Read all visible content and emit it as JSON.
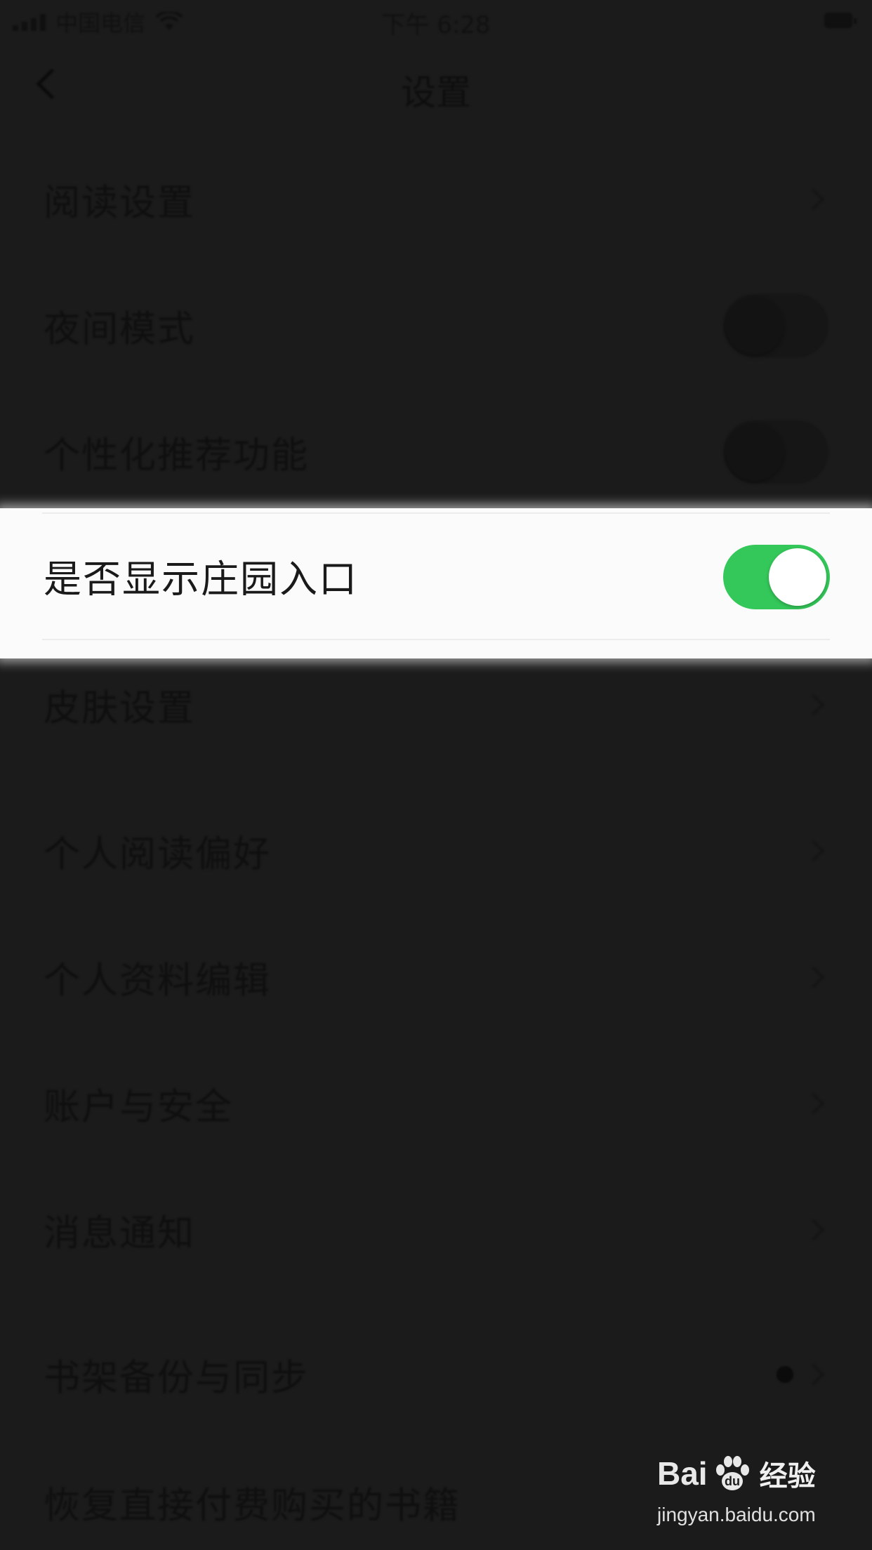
{
  "status_bar": {
    "carrier": "中国电信",
    "time": "下午 6:28"
  },
  "nav": {
    "title": "设置"
  },
  "rows": [
    {
      "label": "阅读设置",
      "accessory": "chevron"
    },
    {
      "label": "夜间模式",
      "accessory": "toggle",
      "on": false
    },
    {
      "label": "个性化推荐功能",
      "accessory": "toggle",
      "on": false
    },
    {
      "label": "是否显示庄园入口",
      "accessory": "toggle",
      "on": true,
      "highlighted": true
    },
    {
      "label": "皮肤设置",
      "accessory": "chevron"
    },
    {
      "label": "个人阅读偏好",
      "accessory": "chevron"
    },
    {
      "label": "个人资料编辑",
      "accessory": "chevron"
    },
    {
      "label": "账户与安全",
      "accessory": "chevron"
    },
    {
      "label": "消息通知",
      "accessory": "chevron"
    },
    {
      "label": "书架备份与同步",
      "accessory": "chevron-with-dot"
    },
    {
      "label": "恢复直接付费购买的书籍",
      "accessory": "none"
    }
  ],
  "colors": {
    "toggle_on": "#34c759",
    "overlay": "#1b1b1b",
    "highlight_bg": "#fbfbfb"
  },
  "watermark": {
    "brand": "Bai",
    "brand_suffix": "du",
    "product": "经验",
    "url": "jingyan.baidu.com"
  }
}
